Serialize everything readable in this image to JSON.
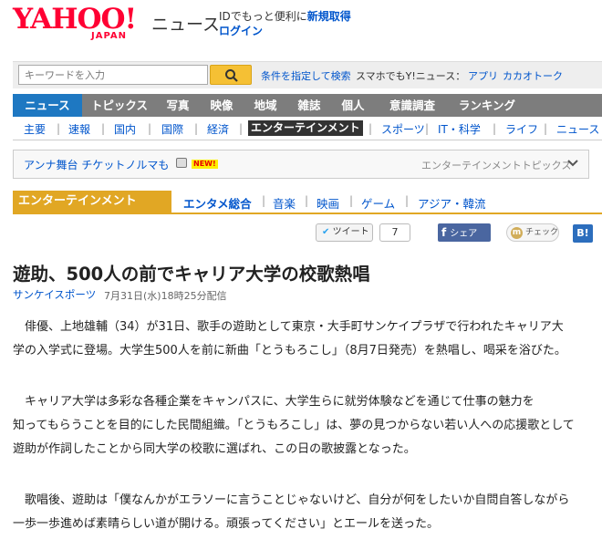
{
  "header": {
    "logo": "YAHOO!",
    "logo_sub": "JAPAN",
    "site_name": "ニュース",
    "promo_text": "IDでもっと便利に",
    "register_link": "新規取得",
    "login_link": "ログイン"
  },
  "search": {
    "placeholder": "キーワードを入力",
    "advanced_link": "条件を指定して検索",
    "mobile_text": "スマホでもY!ニュース：",
    "app_link": "アプリ",
    "kakaotalk_link": "カカオトーク"
  },
  "global_nav": [
    "ニュース",
    "トピックス",
    "写真",
    "映像",
    "地域",
    "雑誌",
    "個人",
    "意識調査",
    "ランキング"
  ],
  "sub_nav": [
    "主要",
    "速報",
    "国内",
    "国際",
    "経済",
    "エンターテインメント",
    "スポーツ",
    "IT・科学",
    "ライフ",
    "ニュース"
  ],
  "topics": {
    "link": "アンナ舞台 チケットノルマも",
    "badge": "NEW!",
    "label": "エンターテインメントトピックス"
  },
  "category": {
    "title": "エンターテインメント",
    "items": [
      "エンタメ総合",
      "音楽",
      "映画",
      "ゲーム",
      "アジア・韓流"
    ]
  },
  "social": {
    "tweet": "ツイート",
    "tweet_count": "7",
    "share": "シェア",
    "check": "チェック",
    "hatena": "B!"
  },
  "article": {
    "title": "遊助、500人の前でキャリア大学の校歌熱唱",
    "source": "サンケイスポーツ",
    "date": "7月31日(水)18時25分配信",
    "paragraphs": [
      [
        "　俳優、上地雄輔（34）が31日、歌手の遊助として東京・大手町サンケイプラザで行われたキャリア大",
        "学の入学式に登場。大学生500人を前に新曲「とうもろこし」（8月7日発売）を熱唱し、喝采を浴びた。"
      ],
      [
        "　キャリア大学は多彩な各種企業をキャンパスに、大学生らに就労体験などを通じて仕事の魅力を",
        "知ってもらうことを目的にした民間組織。「とうもろこし」は、夢の見つからない若い人への応援歌として",
        "遊助が作詞したことから同大学の校歌に選ばれ、この日の歌披露となった。"
      ],
      [
        "　歌唱後、遊助は「僕なんかがエラソーに言うことじゃないけど、自分が何をしたいか自問自答しながら",
        "一歩一歩進めば素晴らしい道が開ける。頑張ってください」とエールを送った。"
      ]
    ]
  },
  "colors": {
    "yahoo_red": "#ff0033",
    "link_blue": "#0055cc",
    "nav_gray": "#7d7d7d",
    "nav_active": "#1e78c2",
    "category_gold": "#e1a724"
  }
}
